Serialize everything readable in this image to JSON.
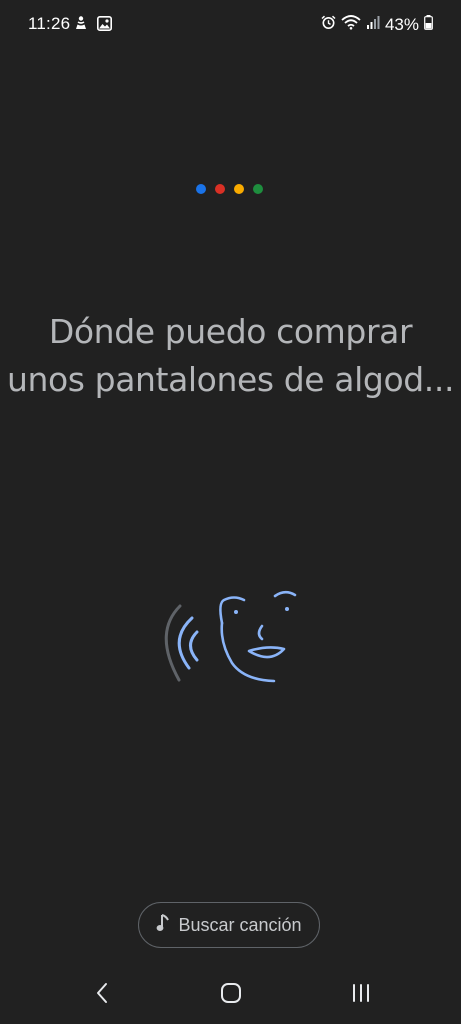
{
  "status_bar": {
    "time": "11:26",
    "battery_percent": "43%",
    "left_icons": [
      "person-notification-icon",
      "image-icon"
    ],
    "right_icons": [
      "alarm-icon",
      "wifi-icon",
      "signal-icon",
      "battery-icon"
    ]
  },
  "assistant": {
    "dot_colors": [
      "#1a73e8",
      "#d93025",
      "#f9ab00",
      "#1e8e3e"
    ],
    "query_line_1": "Dónde puedo comprar",
    "query_line_2": "unos pantalones de algod..."
  },
  "illustration": {
    "icon": "hum-to-search-face-icon",
    "colors": {
      "face": "#8ab4f8",
      "outer_arc": "#5f6368"
    }
  },
  "song_chip": {
    "icon": "music-note-icon",
    "label": "Buscar canción"
  },
  "navigation": {
    "back_icon": "back-icon",
    "home_icon": "home-icon",
    "recents_icon": "recents-icon"
  }
}
